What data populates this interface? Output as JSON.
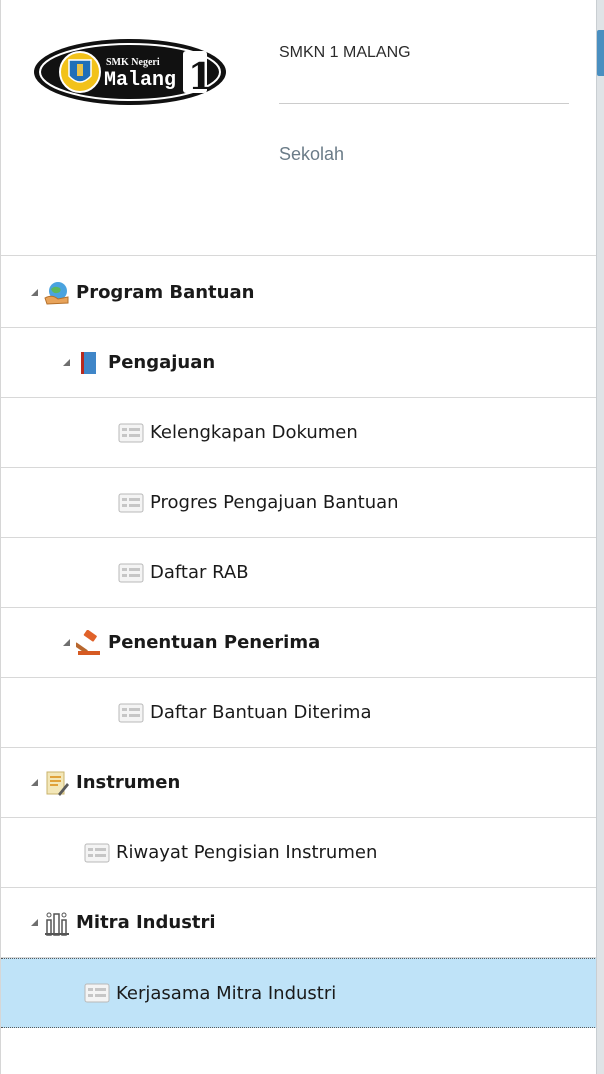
{
  "header": {
    "logo_top": "SMK Negeri",
    "logo_main": "Malang",
    "logo_number": "1",
    "school_name": "SMKN 1 MALANG",
    "role": "Sekolah"
  },
  "tree": {
    "program_bantuan": "Program Bantuan",
    "pengajuan": "Pengajuan",
    "kelengkapan_dokumen": "Kelengkapan Dokumen",
    "progres_pengajuan": "Progres Pengajuan Bantuan",
    "daftar_rab": "Daftar RAB",
    "penentuan_penerima": "Penentuan Penerima",
    "daftar_bantuan_diterima": "Daftar Bantuan Diterima",
    "instrumen": "Instrumen",
    "riwayat_pengisian": "Riwayat Pengisian Instrumen",
    "mitra_industri": "Mitra Industri",
    "kerjasama_mitra": "Kerjasama Mitra Industri"
  },
  "colors": {
    "selected_bg": "#bfe3f8",
    "role_text": "#6b7c88",
    "accent_strip": "#4a8fc0"
  }
}
